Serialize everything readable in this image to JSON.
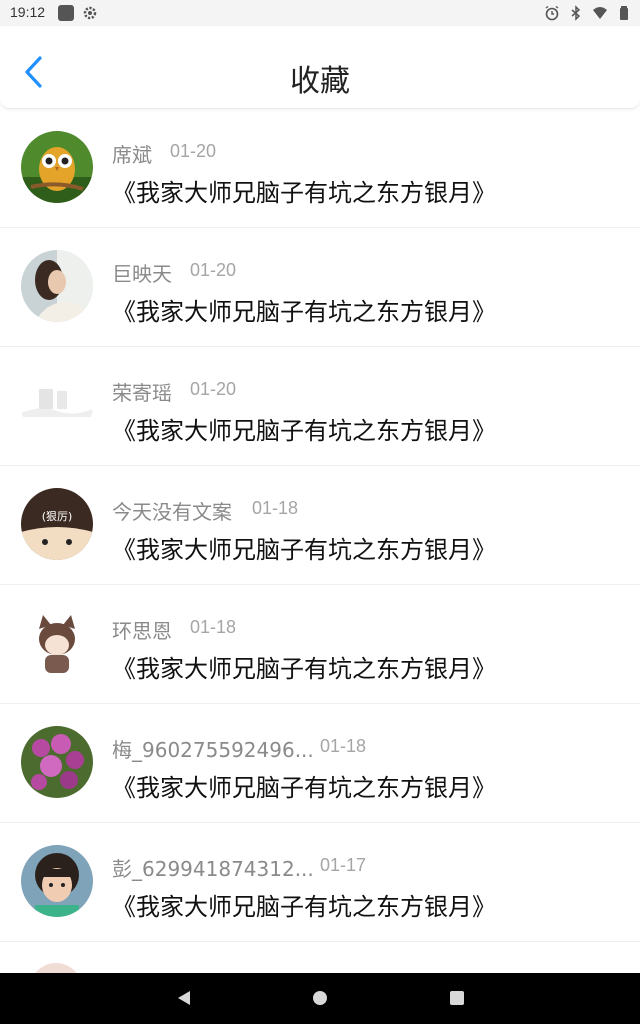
{
  "status_bar": {
    "time": "19:12",
    "left_icons": [
      "notification-square-icon",
      "settings-gear-icon"
    ],
    "right_icons": [
      "alarm-icon",
      "bluetooth-icon",
      "wifi-icon",
      "battery-icon"
    ]
  },
  "header": {
    "title": "收藏",
    "back_icon": "chevron-left-icon",
    "accent_color": "#1e90ff"
  },
  "favorites": [
    {
      "name": "席斌",
      "date": "01-20",
      "book": "《我家大师兄脑子有坑之东方银月》",
      "avatar": "owl"
    },
    {
      "name": "巨映天",
      "date": "01-20",
      "book": "《我家大师兄脑子有坑之东方银月》",
      "avatar": "woman-portrait"
    },
    {
      "name": "荣寄瑶",
      "date": "01-20",
      "book": "《我家大师兄脑子有坑之东方银月》",
      "avatar": "blank-landscape"
    },
    {
      "name": "今天没有文案",
      "date": "01-18",
      "book": "《我家大师兄脑子有坑之东方银月》",
      "avatar": "cartoon-face",
      "avatar_text": "(狠厉)"
    },
    {
      "name": "环思恩",
      "date": "01-18",
      "book": "《我家大师兄脑子有坑之东方银月》",
      "avatar": "cat-ear-girl"
    },
    {
      "name": "梅_960275592496...",
      "date": "01-18",
      "book": "《我家大师兄脑子有坑之东方银月》",
      "avatar": "purple-flowers"
    },
    {
      "name": "彭_629941874312...",
      "date": "01-17",
      "book": "《我家大师兄脑子有坑之东方银月》",
      "avatar": "child-photo"
    }
  ],
  "nav_bar": {
    "buttons": [
      "back-triangle-icon",
      "home-circle-icon",
      "recents-square-icon"
    ]
  }
}
